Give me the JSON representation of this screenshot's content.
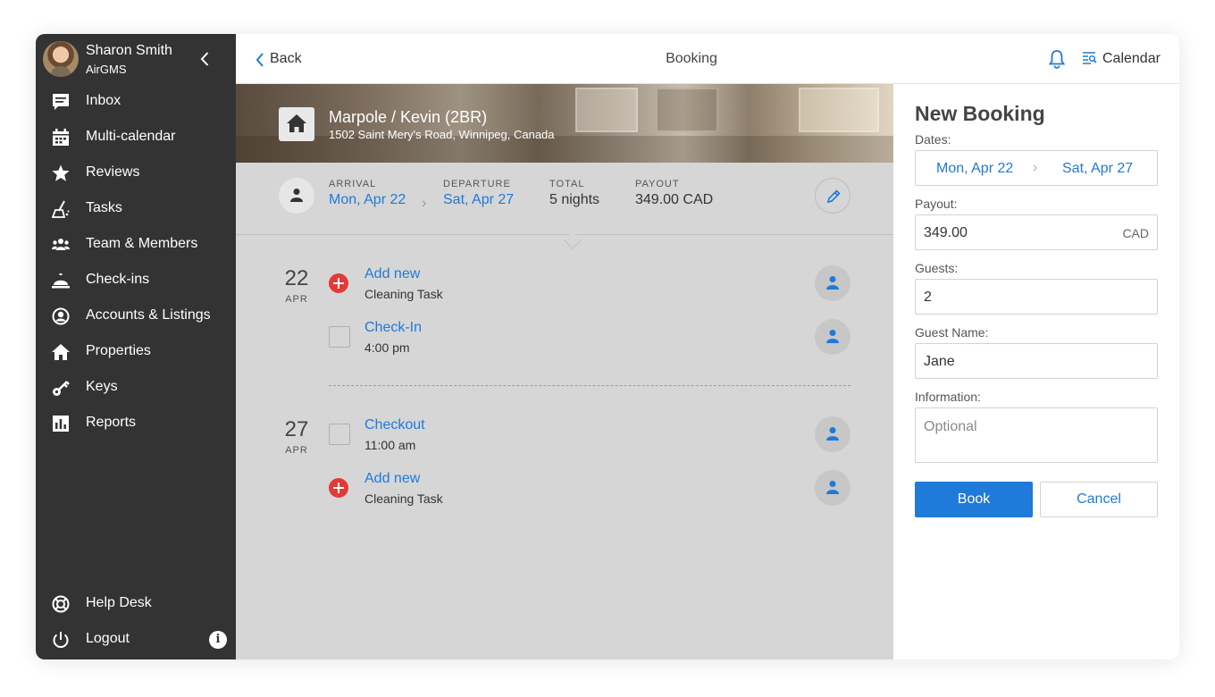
{
  "user": {
    "name": "Sharon Smith",
    "org": "AirGMS"
  },
  "sidebar": {
    "items": [
      {
        "label": "Inbox",
        "icon": "inbox-icon"
      },
      {
        "label": "Multi-calendar",
        "icon": "calendar-icon"
      },
      {
        "label": "Reviews",
        "icon": "star-icon"
      },
      {
        "label": "Tasks",
        "icon": "cleaning-icon"
      },
      {
        "label": "Team & Members",
        "icon": "team-icon"
      },
      {
        "label": "Check-ins",
        "icon": "bell-desk-icon"
      },
      {
        "label": "Accounts & Listings",
        "icon": "user-circle-icon"
      },
      {
        "label": "Properties",
        "icon": "home-icon"
      },
      {
        "label": "Keys",
        "icon": "key-icon"
      },
      {
        "label": "Reports",
        "icon": "reports-icon"
      }
    ],
    "help": "Help Desk",
    "logout": "Logout",
    "info_badge": "i"
  },
  "topbar": {
    "back": "Back",
    "title": "Booking",
    "calendar": "Calendar"
  },
  "property": {
    "name": "Marpole / Kevin (2BR)",
    "address": "1502 Saint Mery's Road, Winnipeg, Canada"
  },
  "summary": {
    "arrival_label": "ARRIVAL",
    "arrival": "Mon, Apr 22",
    "departure_label": "DEPARTURE",
    "departure": "Sat, Apr 27",
    "total_label": "TOTAL",
    "total": "5 nights",
    "payout_label": "PAYOUT",
    "payout": "349.00 CAD"
  },
  "timeline": [
    {
      "day": "22",
      "month": "APR",
      "tasks": [
        {
          "type": "add",
          "title": "Add new",
          "subtitle": "Cleaning Task"
        },
        {
          "type": "checkbox",
          "title": "Check-In",
          "subtitle": "4:00 pm"
        }
      ]
    },
    {
      "day": "27",
      "month": "APR",
      "tasks": [
        {
          "type": "checkbox",
          "title": "Checkout",
          "subtitle": "11:00 am"
        },
        {
          "type": "add",
          "title": "Add new",
          "subtitle": "Cleaning Task"
        }
      ]
    }
  ],
  "panel": {
    "title": "New Booking",
    "dates_label": "Dates:",
    "date_from": "Mon, Apr 22",
    "date_to": "Sat, Apr 27",
    "payout_label": "Payout:",
    "payout_value": "349.00",
    "payout_unit": "CAD",
    "guests_label": "Guests:",
    "guests_value": "2",
    "guest_name_label": "Guest Name:",
    "guest_name_value": "Jane",
    "info_label": "Information:",
    "info_placeholder": "Optional",
    "book": "Book",
    "cancel": "Cancel"
  },
  "colors": {
    "accent": "#1f7ad9",
    "sidebar": "#333333",
    "danger": "#e53935",
    "main_bg": "#d6d6d6"
  }
}
